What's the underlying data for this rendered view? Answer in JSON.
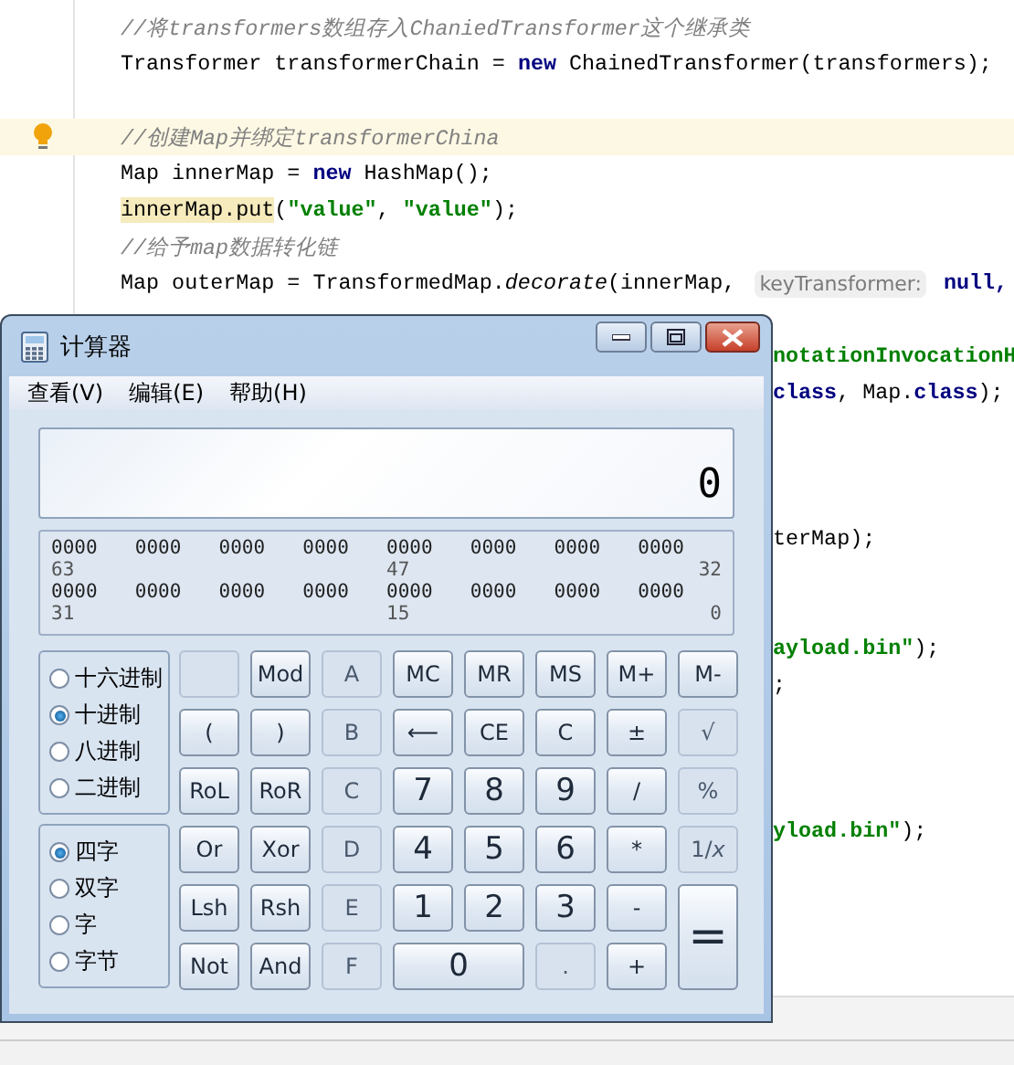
{
  "editor": {
    "code_lines": [
      {
        "segments": [
          {
            "kind": "comment",
            "text": "//将transformers数组存入ChaniedTransformer这个继承类"
          }
        ]
      },
      {
        "segments": [
          {
            "kind": "plain",
            "text": "Transformer transformerChain = "
          },
          {
            "kind": "keyword",
            "text": "new"
          },
          {
            "kind": "plain",
            "text": " ChainedTransformer(transformers);"
          }
        ]
      },
      {
        "kind": "blank"
      },
      {
        "highlighted": true,
        "bulb": true,
        "segments": [
          {
            "kind": "comment",
            "text": "//创建Map并绑定transformerChina"
          }
        ]
      },
      {
        "segments": [
          {
            "kind": "plain",
            "text": "Map innerMap = "
          },
          {
            "kind": "keyword",
            "text": "new"
          },
          {
            "kind": "plain",
            "text": " HashMap();"
          }
        ]
      },
      {
        "segments": [
          {
            "kind": "marked",
            "text": "innerMap.put"
          },
          {
            "kind": "plain",
            "text": "("
          },
          {
            "kind": "string",
            "text": "\"value\""
          },
          {
            "kind": "plain",
            "text": ", "
          },
          {
            "kind": "string",
            "text": "\"value\""
          },
          {
            "kind": "plain",
            "text": ");"
          }
        ]
      },
      {
        "segments": [
          {
            "kind": "comment",
            "text": "//给予map数据转化链"
          }
        ]
      },
      {
        "segments": [
          {
            "kind": "plain",
            "text": "Map outerMap = TransformedMap."
          },
          {
            "kind": "method",
            "text": "decorate"
          },
          {
            "kind": "plain",
            "text": "(innerMap, "
          },
          {
            "kind": "hint",
            "text": "keyTransformer:"
          },
          {
            "kind": "keyword",
            "text": " null,"
          }
        ]
      }
    ],
    "clipped_lines": [
      {
        "kind": "blank"
      },
      {
        "segments": [
          {
            "kind": "string",
            "text": "notationInvocationH"
          }
        ]
      },
      {
        "segments": [
          {
            "kind": "keyword",
            "text": "class"
          },
          {
            "kind": "plain",
            "text": ", Map."
          },
          {
            "kind": "keyword",
            "text": "class"
          },
          {
            "kind": "plain",
            "text": ");"
          }
        ]
      },
      {
        "kind": "blank"
      },
      {
        "kind": "blank"
      },
      {
        "kind": "blank"
      },
      {
        "segments": [
          {
            "kind": "plain",
            "text": "terMap);"
          }
        ]
      },
      {
        "kind": "blank"
      },
      {
        "kind": "blank"
      },
      {
        "segments": [
          {
            "kind": "string",
            "text": "ayload.bin\""
          },
          {
            "kind": "plain",
            "text": ");"
          }
        ]
      },
      {
        "segments": [
          {
            "kind": "plain",
            "text": ";"
          }
        ]
      },
      {
        "kind": "blank"
      },
      {
        "kind": "blank"
      },
      {
        "kind": "blank"
      },
      {
        "segments": [
          {
            "kind": "string",
            "text": "yload.bin\""
          },
          {
            "kind": "plain",
            "text": ");"
          }
        ]
      }
    ]
  },
  "calculator": {
    "title": "计算器",
    "menu": [
      "查看(V)",
      "编辑(E)",
      "帮助(H)"
    ],
    "display": "0",
    "bits": {
      "rows": [
        {
          "groups": [
            "0000",
            "0000",
            "0000",
            "0000",
            "0000",
            "0000",
            "0000",
            "0000"
          ],
          "labels": [
            "63",
            "47",
            "32"
          ]
        },
        {
          "groups": [
            "0000",
            "0000",
            "0000",
            "0000",
            "0000",
            "0000",
            "0000",
            "0000"
          ],
          "labels": [
            "31",
            "15",
            "0"
          ]
        }
      ]
    },
    "bases": [
      {
        "label": "十六进制",
        "selected": false
      },
      {
        "label": "十进制",
        "selected": true
      },
      {
        "label": "八进制",
        "selected": false
      },
      {
        "label": "二进制",
        "selected": false
      }
    ],
    "word_sizes": [
      {
        "label": "四字",
        "selected": true
      },
      {
        "label": "双字",
        "selected": false
      },
      {
        "label": "字",
        "selected": false
      },
      {
        "label": "字节",
        "selected": false
      }
    ],
    "keys": [
      {
        "kind": "blank",
        "disabled": true
      },
      {
        "label": "Mod",
        "disabled": false
      },
      {
        "label": "A",
        "disabled": true
      },
      {
        "label": "MC",
        "disabled": false
      },
      {
        "label": "MR",
        "disabled": false
      },
      {
        "label": "MS",
        "disabled": false
      },
      {
        "label": "M+",
        "disabled": false
      },
      {
        "label": "M-",
        "disabled": false
      },
      {
        "label": "(",
        "disabled": false
      },
      {
        "label": ")",
        "disabled": false
      },
      {
        "label": "B",
        "disabled": true
      },
      {
        "label": "⟵",
        "disabled": false
      },
      {
        "label": "CE",
        "disabled": false
      },
      {
        "label": "C",
        "disabled": false
      },
      {
        "label": "±",
        "disabled": false
      },
      {
        "label": "√",
        "disabled": true
      },
      {
        "label": "RoL",
        "disabled": false
      },
      {
        "label": "RoR",
        "disabled": false
      },
      {
        "label": "C",
        "disabled": true
      },
      {
        "label": "7",
        "disabled": false
      },
      {
        "label": "8",
        "disabled": false
      },
      {
        "label": "9",
        "disabled": false
      },
      {
        "label": "/",
        "disabled": false
      },
      {
        "label": "%",
        "disabled": true
      },
      {
        "label": "Or",
        "disabled": false
      },
      {
        "label": "Xor",
        "disabled": false
      },
      {
        "label": "D",
        "disabled": true
      },
      {
        "label": "4",
        "disabled": false
      },
      {
        "label": "5",
        "disabled": false
      },
      {
        "label": "6",
        "disabled": false
      },
      {
        "label": "*",
        "disabled": false
      },
      {
        "label": "1/*x*",
        "disabled": true
      },
      {
        "label": "Lsh",
        "disabled": false
      },
      {
        "label": "Rsh",
        "disabled": false
      },
      {
        "label": "E",
        "disabled": true
      },
      {
        "label": "1",
        "disabled": false
      },
      {
        "label": "2",
        "disabled": false
      },
      {
        "label": "3",
        "disabled": false
      },
      {
        "label": "-",
        "disabled": false
      },
      {
        "label": "=",
        "kind": "tall",
        "disabled": false
      },
      {
        "label": "Not",
        "disabled": false
      },
      {
        "label": "And",
        "disabled": false
      },
      {
        "label": "F",
        "disabled": true
      },
      {
        "label": "0",
        "kind": "wide",
        "disabled": false
      },
      {
        "label": ".",
        "disabled": true
      },
      {
        "label": "+",
        "disabled": false
      }
    ]
  }
}
